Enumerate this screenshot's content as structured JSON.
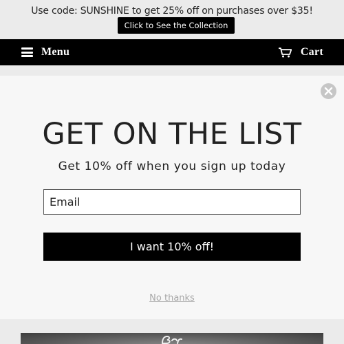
{
  "announcement": {
    "text": "Use code: SUNSHINE to get 25% off on purchases over $35!",
    "button_label": "Click to See the Collection"
  },
  "nav": {
    "menu_label": "Menu",
    "cart_label": "Cart",
    "background": "#000000"
  },
  "popup": {
    "title": "GET ON THE LIST",
    "subtitle": "Get 10% off when you sign up today",
    "email_placeholder": "Email",
    "submit_label": "I want 10% off!",
    "dismiss_label": "No thanks",
    "close_icon": "close-icon"
  },
  "colors": {
    "accent": "#000000",
    "page_background": "#ebebeb",
    "popup_background": "#f7f7f7",
    "dismiss_text": "#a8a8a8"
  }
}
